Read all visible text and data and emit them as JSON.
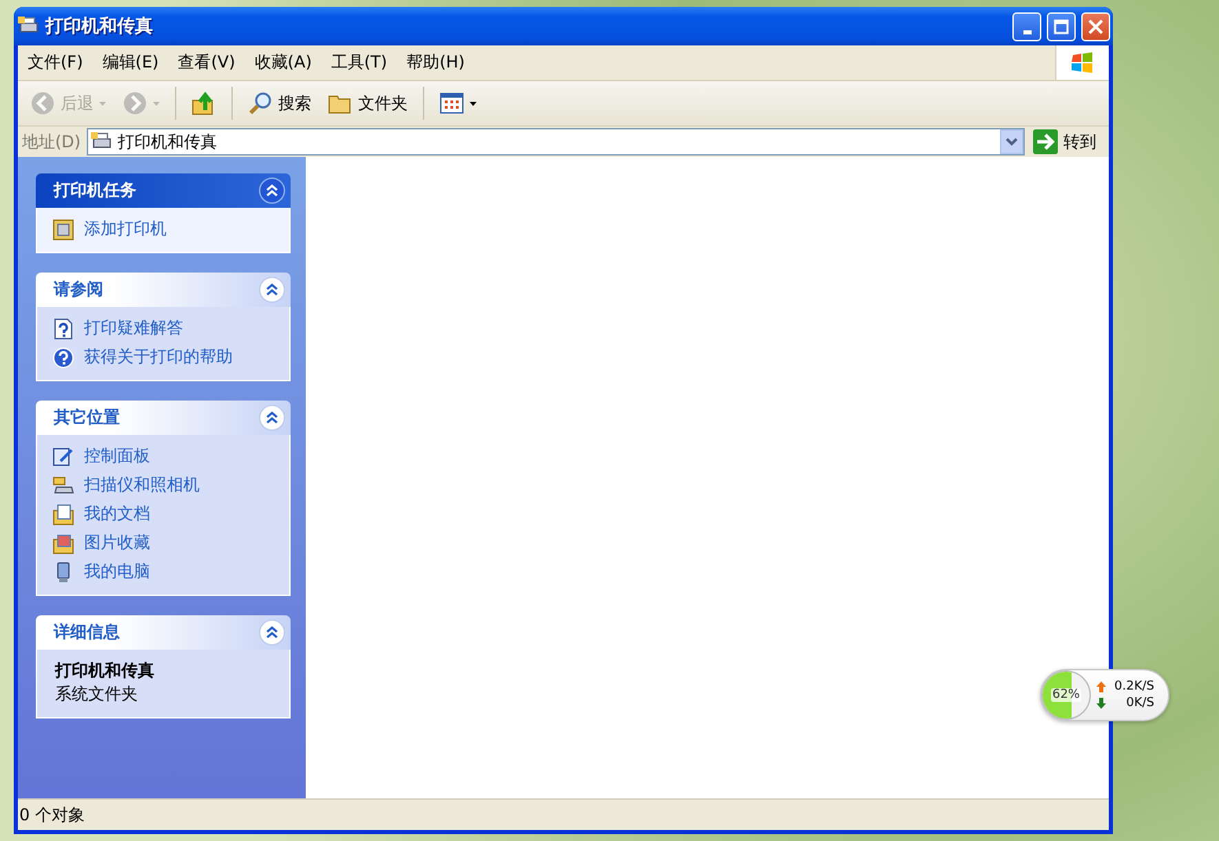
{
  "window": {
    "title": "打印机和传真"
  },
  "menu": [
    "文件(F)",
    "编辑(E)",
    "查看(V)",
    "收藏(A)",
    "工具(T)",
    "帮助(H)"
  ],
  "toolbar": [
    {
      "kind": "back",
      "label": "后退",
      "disabled": true
    },
    {
      "kind": "forward",
      "disabled": true
    },
    {
      "kind": "up",
      "disabled": false
    },
    {
      "kind": "search",
      "label": "搜索",
      "disabled": false
    },
    {
      "kind": "folders",
      "label": "文件夹",
      "disabled": false
    },
    {
      "kind": "views",
      "disabled": false
    }
  ],
  "address": {
    "label": "地址(D)",
    "value": "打印机和传真",
    "go": "转到"
  },
  "sidebar": {
    "panels": [
      {
        "kind": "special",
        "title": "打印机任务",
        "expanded": true,
        "items": [
          {
            "kind": "add-printer",
            "label": "添加打印机"
          }
        ]
      },
      {
        "kind": "normal",
        "title": "请参阅",
        "expanded": true,
        "items": [
          {
            "kind": "help-doc",
            "label": "打印疑难解答"
          },
          {
            "kind": "help",
            "label": "获得关于打印的帮助"
          }
        ]
      },
      {
        "kind": "normal",
        "title": "其它位置",
        "expanded": true,
        "items": [
          {
            "kind": "control-panel",
            "label": "控制面板"
          },
          {
            "kind": "scanner",
            "label": "扫描仪和照相机"
          },
          {
            "kind": "documents",
            "label": "我的文档"
          },
          {
            "kind": "pictures",
            "label": "图片收藏"
          },
          {
            "kind": "computer",
            "label": "我的电脑"
          }
        ]
      },
      {
        "kind": "details",
        "title": "详细信息",
        "expanded": true,
        "name": "打印机和传真",
        "description": "系统文件夹"
      }
    ]
  },
  "status_bar": "0 个对象",
  "net_widget": {
    "percent": "62%",
    "level": 0.62,
    "upload": "0.2K/S",
    "download": "0K/S"
  }
}
